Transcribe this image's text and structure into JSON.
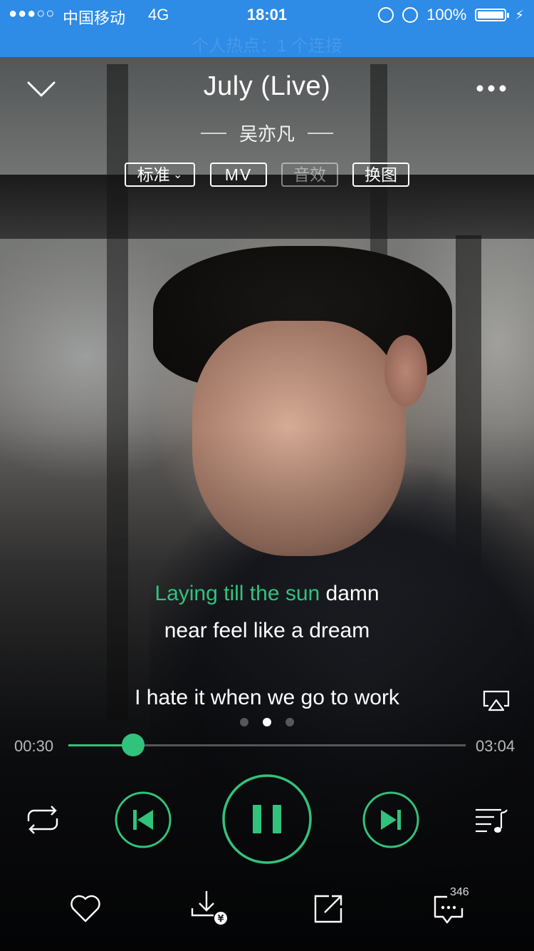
{
  "status_bar": {
    "signal": "●●●○○",
    "carrier": "中国移动",
    "network": "4G",
    "time": "18:01",
    "battery": "100%",
    "ghost_text": "个人热点：1 个连接"
  },
  "player": {
    "title": "July (Live)",
    "artist": "吴亦凡",
    "tags": {
      "quality": "标准",
      "mv": "MV",
      "effects": "音效",
      "change_image": "换图"
    },
    "lyrics": {
      "line1_sung": "Laying till the sun",
      "line1_rest": " damn",
      "line2": "near feel like a dream",
      "next_line": "I hate it when we go to work"
    },
    "page_dots": {
      "count": 3,
      "active": 1
    },
    "current_time": "00:30",
    "total_time": "03:04",
    "progress": 0.163,
    "comment_count": "346",
    "accent_color": "#31c27c"
  },
  "icons": {
    "collapse": "chevron-down-icon",
    "more": "more-dots-icon",
    "airplay": "airplay-icon",
    "repeat": "repeat-icon",
    "previous": "skip-previous-icon",
    "pause": "pause-icon",
    "next": "skip-next-icon",
    "playlist": "playlist-icon",
    "like": "heart-icon",
    "download": "download-icon",
    "share": "share-icon",
    "comment": "comment-icon"
  }
}
